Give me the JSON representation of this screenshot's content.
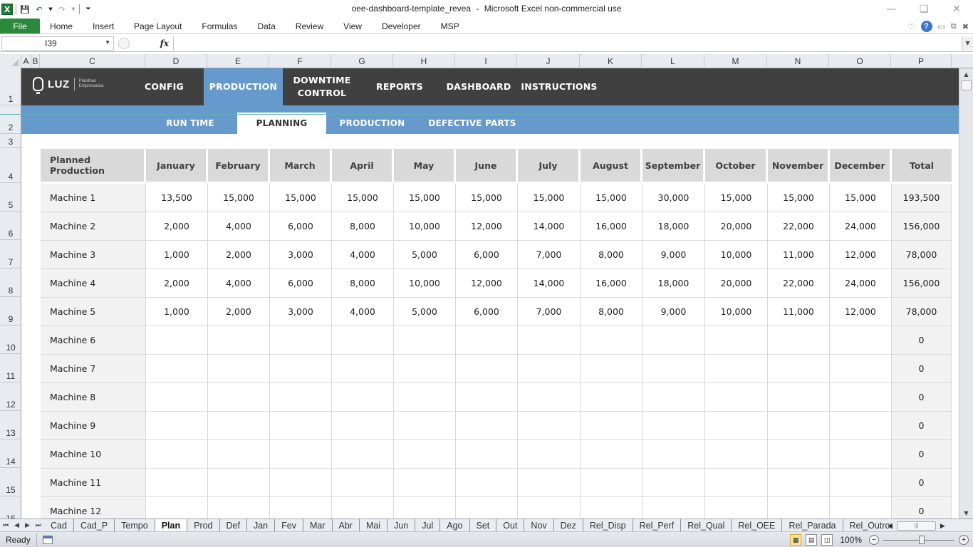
{
  "window": {
    "title": "oee-dashboard-template_revea",
    "app_name": "Microsoft Excel non-commercial use",
    "title_separator": "-",
    "controls": [
      "minimize",
      "restore",
      "close"
    ]
  },
  "ribbon": {
    "tabs": [
      "File",
      "Home",
      "Insert",
      "Page Layout",
      "Formulas",
      "Data",
      "Review",
      "View",
      "Developer",
      "MSP"
    ],
    "help_icon": "?"
  },
  "formula_bar": {
    "name_box": "I39",
    "fx_label": "fx",
    "formula": ""
  },
  "columns": [
    "A",
    "B",
    "C",
    "D",
    "E",
    "F",
    "G",
    "H",
    "I",
    "J",
    "K",
    "L",
    "M",
    "N",
    "O",
    "P"
  ],
  "rows": [
    "1",
    "2",
    "3",
    "4",
    "5",
    "6",
    "7",
    "8",
    "9",
    "10",
    "11",
    "12",
    "13",
    "14",
    "15",
    "16"
  ],
  "brand": {
    "logo_text": "LUZ",
    "logo_sub1": "Planilhas",
    "logo_sub2": "Empresariais",
    "dark_color": "#404040",
    "accent_color": "#6699cc"
  },
  "main_nav": [
    {
      "label": "CONFIG",
      "active": false
    },
    {
      "label": "PRODUCTION",
      "active": true
    },
    {
      "label": "DOWNTIME CONTROL",
      "line1": "DOWNTIME",
      "line2": "CONTROL",
      "active": false
    },
    {
      "label": "REPORTS",
      "active": false
    },
    {
      "label": "DASHBOARD",
      "active": false
    },
    {
      "label": "INSTRUCTIONS",
      "active": false
    }
  ],
  "sub_nav": [
    {
      "label": "RUN TIME",
      "active": false
    },
    {
      "label": "PLANNING",
      "active": true
    },
    {
      "label": "PRODUCTION",
      "active": false
    },
    {
      "label": "DEFECTIVE PARTS",
      "active": false
    }
  ],
  "table": {
    "headers": [
      "Planned Production",
      "January",
      "February",
      "March",
      "April",
      "May",
      "June",
      "July",
      "August",
      "September",
      "October",
      "November",
      "December",
      "Total"
    ],
    "rows": [
      {
        "name": "Machine 1",
        "values": [
          "13,500",
          "15,000",
          "15,000",
          "15,000",
          "15,000",
          "15,000",
          "15,000",
          "15,000",
          "30,000",
          "15,000",
          "15,000",
          "15,000"
        ],
        "total": "193,500"
      },
      {
        "name": "Machine 2",
        "values": [
          "2,000",
          "4,000",
          "6,000",
          "8,000",
          "10,000",
          "12,000",
          "14,000",
          "16,000",
          "18,000",
          "20,000",
          "22,000",
          "24,000"
        ],
        "total": "156,000"
      },
      {
        "name": "Machine 3",
        "values": [
          "1,000",
          "2,000",
          "3,000",
          "4,000",
          "5,000",
          "6,000",
          "7,000",
          "8,000",
          "9,000",
          "10,000",
          "11,000",
          "12,000"
        ],
        "total": "78,000"
      },
      {
        "name": "Machine 4",
        "values": [
          "2,000",
          "4,000",
          "6,000",
          "8,000",
          "10,000",
          "12,000",
          "14,000",
          "16,000",
          "18,000",
          "20,000",
          "22,000",
          "24,000"
        ],
        "total": "156,000"
      },
      {
        "name": "Machine 5",
        "values": [
          "1,000",
          "2,000",
          "3,000",
          "4,000",
          "5,000",
          "6,000",
          "7,000",
          "8,000",
          "9,000",
          "10,000",
          "11,000",
          "12,000"
        ],
        "total": "78,000"
      },
      {
        "name": "Machine 6",
        "values": [
          "",
          "",
          "",
          "",
          "",
          "",
          "",
          "",
          "",
          "",
          "",
          ""
        ],
        "total": "0"
      },
      {
        "name": "Machine 7",
        "values": [
          "",
          "",
          "",
          "",
          "",
          "",
          "",
          "",
          "",
          "",
          "",
          ""
        ],
        "total": "0"
      },
      {
        "name": "Machine 8",
        "values": [
          "",
          "",
          "",
          "",
          "",
          "",
          "",
          "",
          "",
          "",
          "",
          ""
        ],
        "total": "0"
      },
      {
        "name": "Machine 9",
        "values": [
          "",
          "",
          "",
          "",
          "",
          "",
          "",
          "",
          "",
          "",
          "",
          ""
        ],
        "total": "0"
      },
      {
        "name": "Machine 10",
        "values": [
          "",
          "",
          "",
          "",
          "",
          "",
          "",
          "",
          "",
          "",
          "",
          ""
        ],
        "total": "0"
      },
      {
        "name": "Machine 11",
        "values": [
          "",
          "",
          "",
          "",
          "",
          "",
          "",
          "",
          "",
          "",
          "",
          ""
        ],
        "total": "0"
      },
      {
        "name": "Machine 12",
        "values": [
          "",
          "",
          "",
          "",
          "",
          "",
          "",
          "",
          "",
          "",
          "",
          ""
        ],
        "total": "0"
      }
    ]
  },
  "sheet_tabs": {
    "active": "Plan",
    "tabs": [
      "Cad",
      "Cad_P",
      "Tempo",
      "Plan",
      "Prod",
      "Def",
      "Jan",
      "Fev",
      "Mar",
      "Abr",
      "Mai",
      "Jun",
      "Jul",
      "Ago",
      "Set",
      "Out",
      "Nov",
      "Dez",
      "Rel_Disp",
      "Rel_Perf",
      "Rel_Qual",
      "Rel_OEE",
      "Rel_Parada",
      "Rel_Outros"
    ]
  },
  "status_bar": {
    "status": "Ready",
    "zoom": "100%"
  }
}
